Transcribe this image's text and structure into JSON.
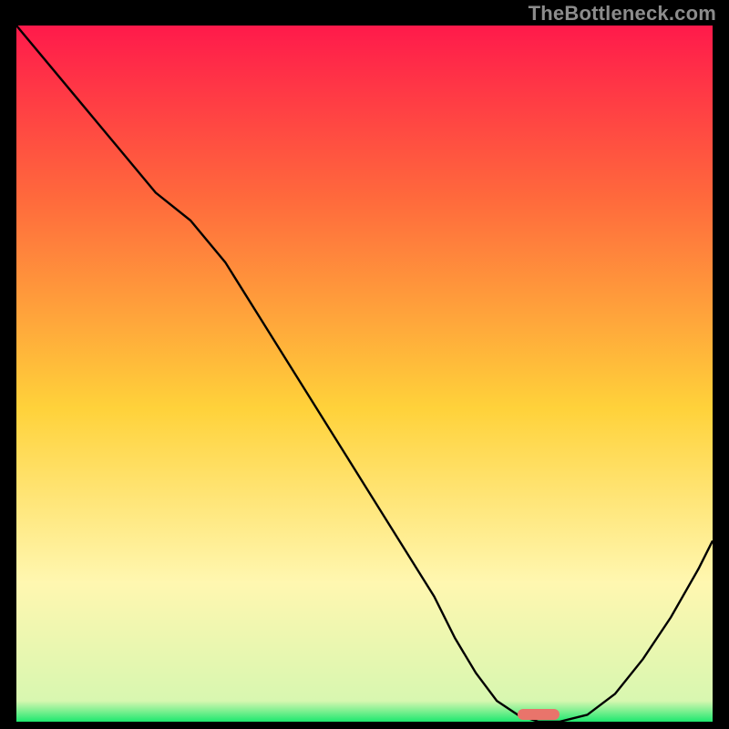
{
  "watermark": "TheBottleneck.com",
  "colors": {
    "gradient_top": "#ff1a4b",
    "gradient_mid1": "#ff6a3c",
    "gradient_mid2": "#ffd23a",
    "gradient_mid3": "#fff7b0",
    "gradient_bottom": "#1ee86f",
    "curve": "#000000",
    "marker": "#e9746b",
    "frame_bg": "#000000"
  },
  "chart_data": {
    "type": "line",
    "title": "",
    "xlabel": "",
    "ylabel": "",
    "xlim": [
      0,
      100
    ],
    "ylim": [
      0,
      100
    ],
    "series": [
      {
        "name": "bottleneck-curve",
        "x": [
          0,
          5,
          10,
          15,
          20,
          25,
          30,
          35,
          40,
          45,
          50,
          55,
          60,
          63,
          66,
          69,
          72,
          75,
          78,
          82,
          86,
          90,
          94,
          98,
          100
        ],
        "y": [
          100,
          94,
          88,
          82,
          76,
          72,
          66,
          58,
          50,
          42,
          34,
          26,
          18,
          12,
          7,
          3,
          1,
          0,
          0,
          1,
          4,
          9,
          15,
          22,
          26
        ]
      }
    ],
    "annotations": [
      {
        "name": "optimal-marker",
        "x": 75,
        "width_pct": 6,
        "y": 0
      }
    ],
    "background_gradient_stops": [
      {
        "pct": 0,
        "hex": "#ff1a4b"
      },
      {
        "pct": 25,
        "hex": "#ff6a3c"
      },
      {
        "pct": 55,
        "hex": "#ffd23a"
      },
      {
        "pct": 80,
        "hex": "#fff7b0"
      },
      {
        "pct": 97,
        "hex": "#d8f7b0"
      },
      {
        "pct": 100,
        "hex": "#1ee86f"
      }
    ]
  }
}
